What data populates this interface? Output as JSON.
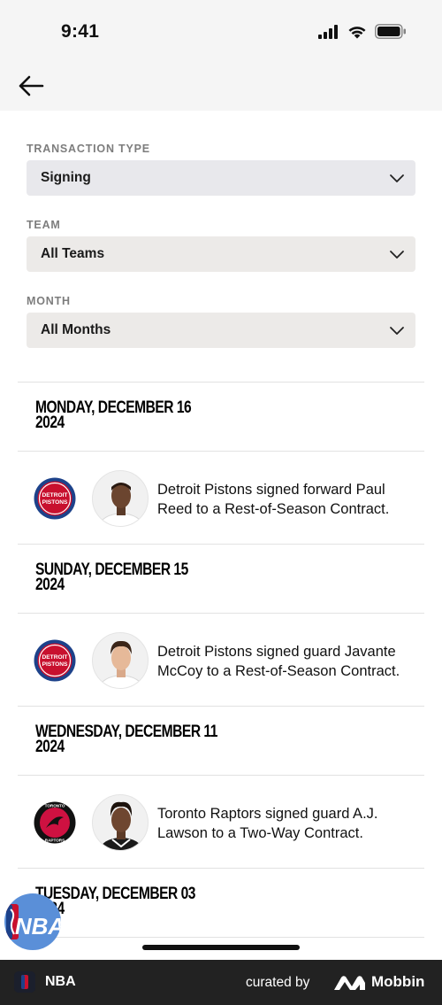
{
  "status_bar": {
    "time": "9:41"
  },
  "filters": [
    {
      "label": "TRANSACTION TYPE",
      "value": "Signing"
    },
    {
      "label": "TEAM",
      "value": "All Teams"
    },
    {
      "label": "MONTH",
      "value": "All Months"
    }
  ],
  "groups": [
    {
      "date_line1": "MONDAY, DECEMBER 16",
      "date_line2": "2024",
      "transaction": {
        "team": "Detroit Pistons",
        "team_logo_text": [
          "DETROIT",
          "PISTONS"
        ],
        "text": "Detroit Pistons signed forward Paul Reed to a Rest-of-Season Contract."
      }
    },
    {
      "date_line1": "SUNDAY, DECEMBER 15",
      "date_line2": "2024",
      "transaction": {
        "team": "Detroit Pistons",
        "team_logo_text": [
          "DETROIT",
          "PISTONS"
        ],
        "text": "Detroit Pistons signed guard Javante McCoy to a Rest-of-Season Contract."
      }
    },
    {
      "date_line1": "WEDNESDAY, DECEMBER 11",
      "date_line2": "2024",
      "transaction": {
        "team": "Toronto Raptors",
        "team_logo_text": [
          "TORONTO",
          "RAPTORS"
        ],
        "text": "Toronto Raptors signed guard A.J. Lawson to a Two-Way Contract."
      }
    },
    {
      "date_line1": "TUESDAY, DECEMBER 03",
      "date_line2": "2024"
    }
  ],
  "floating_badge": {
    "logo_text": "NBA"
  },
  "footer": {
    "app_name": "NBA",
    "curated_by": "curated by",
    "brand": "Mobbin"
  },
  "colors": {
    "pistons_blue": "#1d428a",
    "pistons_red": "#c8102e",
    "raptors_red": "#ce1141",
    "nba_blue": "#5a8fd8",
    "footer_bg": "#222222"
  }
}
